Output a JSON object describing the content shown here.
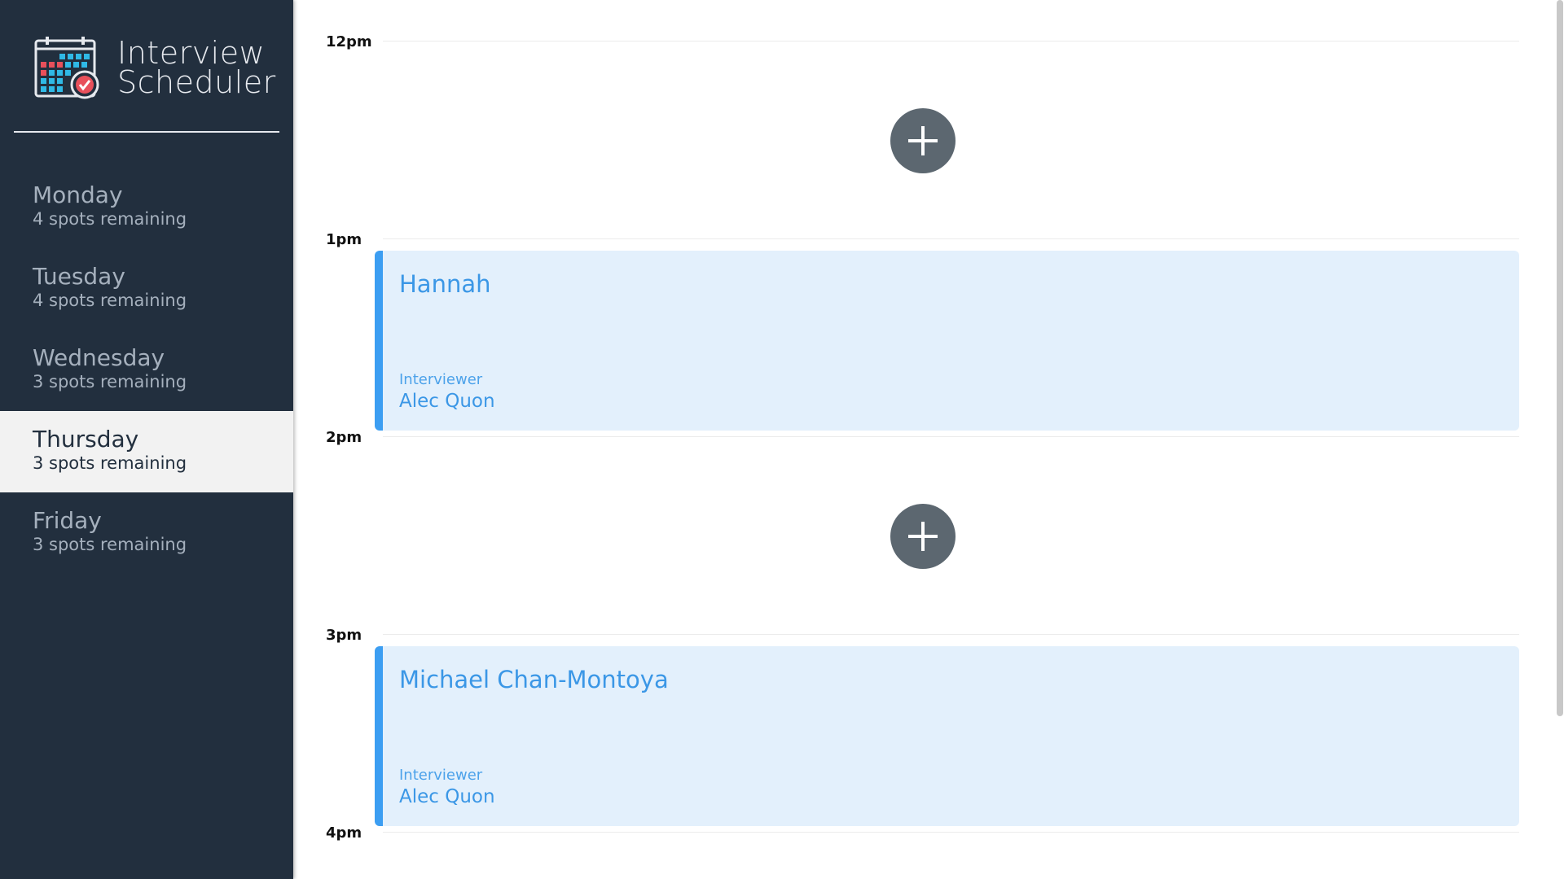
{
  "app": {
    "title_line1": "Interview",
    "title_line2": "Scheduler",
    "logo_icon": "calendar-check-icon"
  },
  "days": [
    {
      "name": "Monday",
      "spots": "4 spots remaining",
      "selected": false
    },
    {
      "name": "Tuesday",
      "spots": "4 spots remaining",
      "selected": false
    },
    {
      "name": "Wednesday",
      "spots": "3 spots remaining",
      "selected": false
    },
    {
      "name": "Thursday",
      "spots": "3 spots remaining",
      "selected": true
    },
    {
      "name": "Friday",
      "spots": "3 spots remaining",
      "selected": false
    }
  ],
  "slots": [
    {
      "time": "12pm",
      "type": "empty",
      "add_icon": "plus-icon"
    },
    {
      "time": "1pm",
      "type": "booked",
      "student": "Hannah",
      "interviewer_label": "Interviewer",
      "interviewer": "Alec Quon"
    },
    {
      "time": "2pm",
      "type": "empty",
      "add_icon": "plus-icon"
    },
    {
      "time": "3pm",
      "type": "booked",
      "student": "Michael Chan-Montoya",
      "interviewer_label": "Interviewer",
      "interviewer": "Alec Quon"
    },
    {
      "time": "4pm",
      "type": "end"
    }
  ],
  "colors": {
    "sidebar_bg": "#222f3e",
    "selected_bg": "#f2f2f2",
    "appointment_bg": "#e3f0fc",
    "appointment_accent": "#3c9ef2",
    "add_button": "#5c6770"
  }
}
